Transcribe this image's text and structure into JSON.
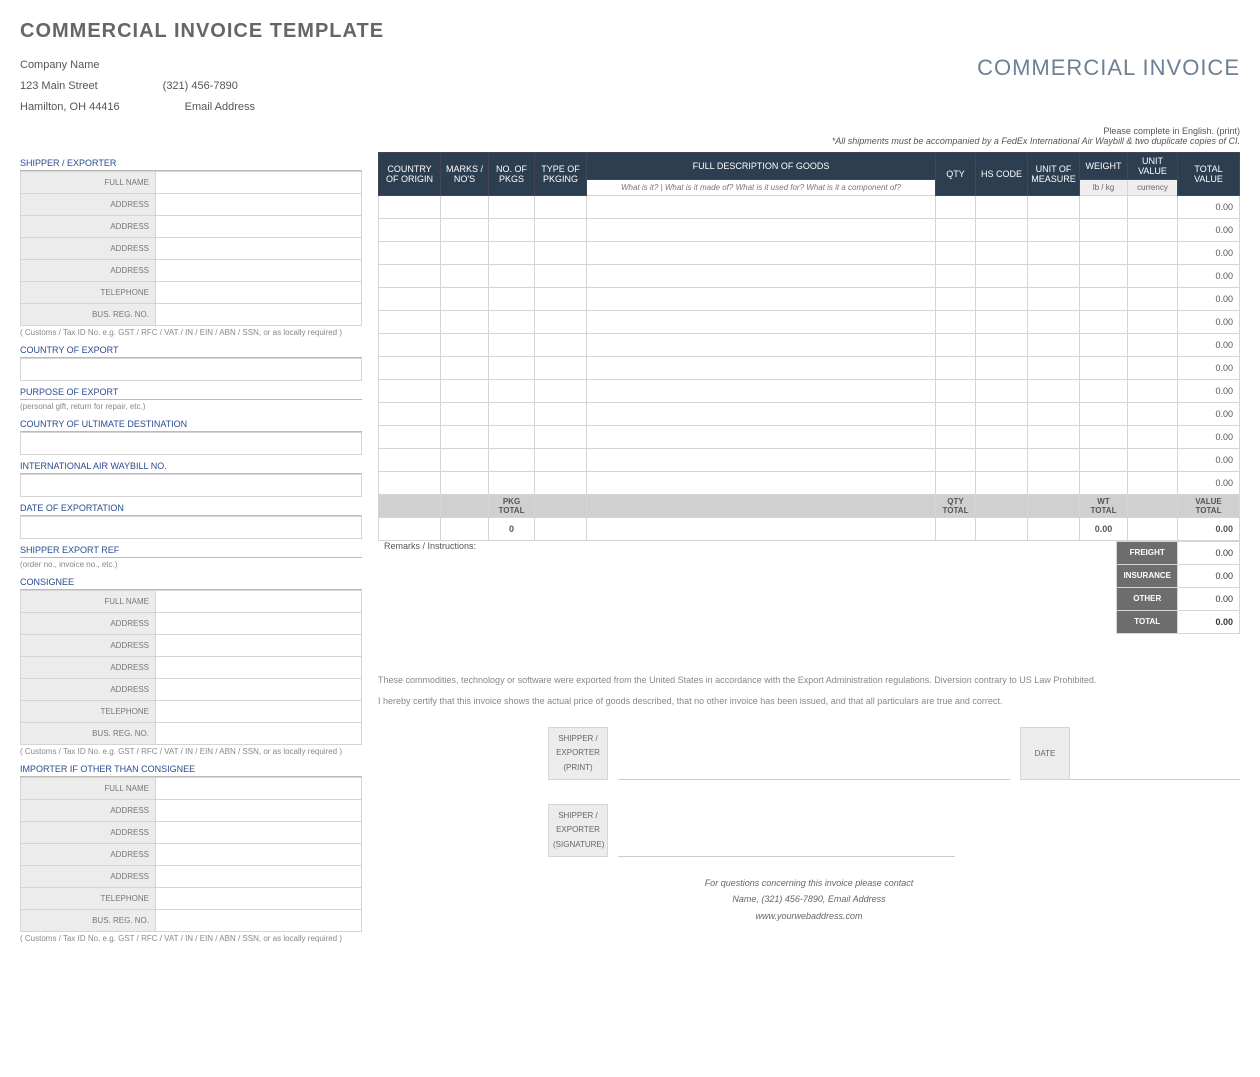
{
  "title": "COMMERCIAL INVOICE TEMPLATE",
  "doc_title": "COMMERCIAL INVOICE",
  "company": {
    "name": "Company Name",
    "street": "123 Main Street",
    "city": "Hamilton, OH  44416",
    "phone": "(321) 456-7890",
    "email": "Email Address"
  },
  "instr1": "Please complete in English. (print)",
  "instr2": "*All shipments must be accompanied by a FedEx International Air Waybill & two duplicate copies of CI.",
  "sections": {
    "shipper": "SHIPPER / EXPORTER",
    "country_export": "COUNTRY OF EXPORT",
    "purpose": "PURPOSE OF EXPORT",
    "purpose_hint": "(personal gift, return for repair, etc.)",
    "ultimate": "COUNTRY OF ULTIMATE DESTINATION",
    "waybill": "INTERNATIONAL AIR WAYBILL NO.",
    "date_export": "DATE OF EXPORTATION",
    "ship_ref": "SHIPPER EXPORT REF",
    "ship_ref_hint": "(order no., invoice no., etc.)",
    "consignee": "CONSIGNEE",
    "importer": "IMPORTER IF OTHER THAN CONSIGNEE",
    "tax_hint": "( Customs / Tax ID No. e.g. GST / RFC / VAT / IN / EIN / ABN / SSN, or as locally required )"
  },
  "labels": {
    "full_name": "FULL NAME",
    "address": "ADDRESS",
    "telephone": "TELEPHONE",
    "bus_reg": "BUS. REG. NO."
  },
  "table": {
    "h": {
      "country": "COUNTRY OF ORIGIN",
      "marks": "MARKS / NO'S",
      "no_pkgs": "NO. OF PKGS",
      "type_pkg": "TYPE OF PKGING",
      "desc": "FULL DESCRIPTION OF GOODS",
      "desc_sub": "What is it? | What is it made of? What is it used for? What is it a component of?",
      "qty": "QTY",
      "hs": "HS CODE",
      "uom": "UNIT OF MEASURE",
      "weight": "WEIGHT",
      "weight_sub": "lb / kg",
      "uval": "UNIT VALUE",
      "uval_sub": "currency",
      "total": "TOTAL VALUE"
    },
    "rows_value": "0.00",
    "totals": {
      "pkg": "PKG TOTAL",
      "pkg_v": "0",
      "qty": "QTY TOTAL",
      "wt": "WT TOTAL",
      "wt_v": "0.00",
      "val": "VALUE TOTAL",
      "val_v": "0.00"
    }
  },
  "summary": {
    "remarks": "Remarks / Instructions:",
    "freight": "FREIGHT",
    "insurance": "INSURANCE",
    "other": "OTHER",
    "total": "TOTAL",
    "v": "0.00",
    "tv": "0.00"
  },
  "legal1": "These commodities, technology or software were exported from the United States in accordance with the Export Administration regulations.  Diversion contrary to US Law Prohibited.",
  "legal2": "I hereby certify that this invoice shows the actual price of goods described, that no other invoice has been issued, and that all particulars are true and correct.",
  "sign": {
    "print": "SHIPPER / EXPORTER (PRINT)",
    "sig": "SHIPPER / EXPORTER (SIGNATURE)",
    "date": "DATE"
  },
  "footer": {
    "q": "For questions concerning this invoice please contact",
    "c": "Name, (321) 456-7890, Email Address",
    "w": "www.yourwebaddress.com"
  }
}
